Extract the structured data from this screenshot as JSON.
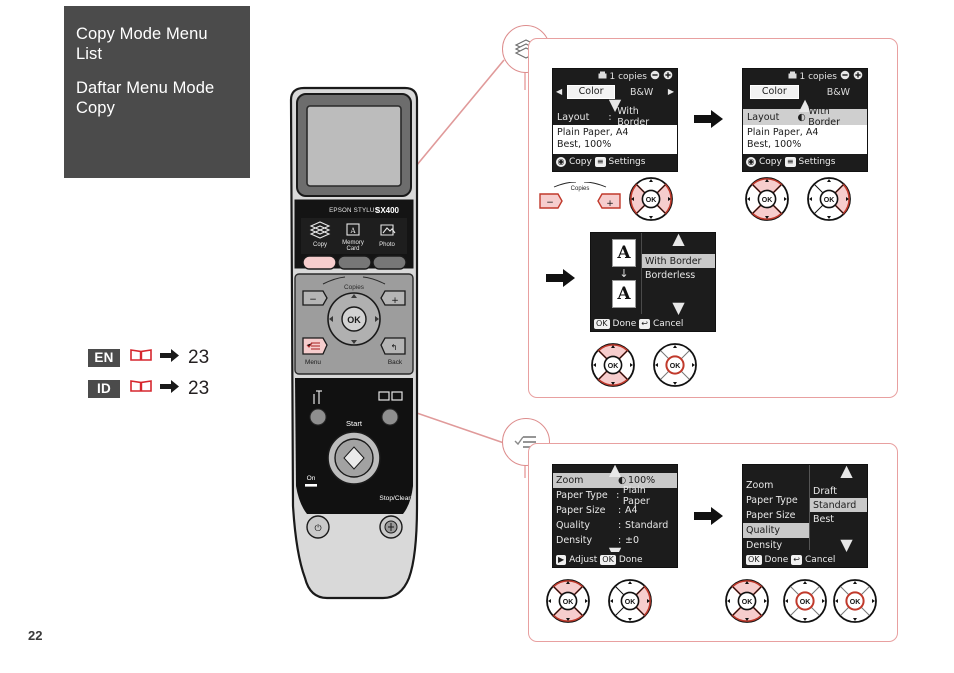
{
  "folio": "22",
  "title_panel": {
    "line_en": "Copy Mode Menu List",
    "line_id": "Daftar Menu Mode Copy"
  },
  "legend": {
    "rows": [
      {
        "lang": "EN",
        "icon": "book-icon",
        "arrow": "right-arrow-icon",
        "page": "23"
      },
      {
        "lang": "ID",
        "icon": "book-icon",
        "arrow": "right-arrow-icon",
        "page": "23"
      }
    ]
  },
  "printer": {
    "brand": "EPSON STYLUS",
    "model": "SX400",
    "mode_buttons": [
      {
        "label": "Copy",
        "icon": "copy-stack-icon"
      },
      {
        "label": "Memory Card",
        "icon": "memory-card-icon"
      },
      {
        "label": "Photo",
        "icon": "photo-icon"
      }
    ],
    "copies_label": "Copies",
    "minus_label": "−",
    "plus_label": "+",
    "ok_label": "OK",
    "menu_label": "Menu",
    "back_label": "Back",
    "start_label": "Start",
    "on_label": "On",
    "stop_clear_label": "Stop/Clear",
    "maintenance_icon": "tools-icon",
    "display_icon": "display-switch-icon",
    "power_icon": "power-icon"
  },
  "callouts": {
    "copy": {
      "badge_icon": "copy-stack-icon"
    },
    "menu": {
      "badge_icon": "menu-list-icon"
    }
  },
  "screens": {
    "copy_home": {
      "copies_icon": "printer-icon",
      "copies_value": "1 copies",
      "minus_icon": "minus-circle-icon",
      "plus_icon": "plus-circle-icon",
      "left_arrow": "◀",
      "right_arrow": "▶",
      "mode_selected": "Color",
      "mode_other": "B&W",
      "caret": "▼",
      "layout_key": "Layout",
      "layout_sep": ":",
      "layout_value": "With Border",
      "paper_line1": "Plain Paper, A4",
      "paper_line2": "Best, 100%",
      "footer_copy_key": "◉",
      "footer_copy": "Copy",
      "footer_settings_key": "≡",
      "footer_settings": "Settings"
    },
    "copy_layout_selected": {
      "copies_icon": "printer-icon",
      "copies_value": "1 copies",
      "minus_icon": "minus-circle-icon",
      "plus_icon": "plus-circle-icon",
      "mode_selected": "Color",
      "mode_other": "B&W",
      "caret": "▲",
      "layout_key": "Layout",
      "layout_bullet": "◐",
      "layout_value": "With Border",
      "paper_line1": "Plain Paper, A4",
      "paper_line2": "Best, 100%",
      "footer_copy_key": "◉",
      "footer_copy": "Copy",
      "footer_settings_key": "≡",
      "footer_settings": "Settings"
    },
    "layout_choice": {
      "preview_top": "A",
      "preview_arrow": "↓",
      "preview_bottom": "A",
      "scroll_up": "▲",
      "scroll_down": "▼",
      "options": [
        {
          "label": "With Border",
          "selected": true
        },
        {
          "label": "Borderless",
          "selected": false
        }
      ],
      "footer_ok_key": "OK",
      "footer_ok": "Done",
      "footer_cancel_key": "↩",
      "footer_cancel": "Cancel"
    },
    "settings_list": {
      "scroll_up": "▲",
      "scroll_down": "▼",
      "rows": [
        {
          "key": "Zoom",
          "sep": "",
          "bullet": "◐",
          "value": "100%",
          "highlight": true
        },
        {
          "key": "Paper Type",
          "sep": ":",
          "bullet": "",
          "value": "Plain Paper",
          "highlight": false
        },
        {
          "key": "Paper Size",
          "sep": ":",
          "bullet": "",
          "value": "A4",
          "highlight": false
        },
        {
          "key": "Quality",
          "sep": ":",
          "bullet": "",
          "value": "Standard",
          "highlight": false
        },
        {
          "key": "Density",
          "sep": ":",
          "bullet": "",
          "value": "±0",
          "highlight": false
        }
      ],
      "footer_adjust_key": "▶",
      "footer_adjust": "Adjust",
      "footer_ok_key": "OK",
      "footer_ok": "Done"
    },
    "quality_dropdown": {
      "scroll_up": "▲",
      "scroll_down": "▼",
      "rows": [
        {
          "key": "Zoom",
          "highlight": false
        },
        {
          "key": "Paper Type",
          "highlight": false
        },
        {
          "key": "Paper Size",
          "highlight": false
        },
        {
          "key": "Quality",
          "highlight": true
        },
        {
          "key": "Density",
          "highlight": false
        }
      ],
      "options": [
        {
          "label": "Draft",
          "selected": false
        },
        {
          "label": "Standard",
          "selected": true
        },
        {
          "label": "Best",
          "selected": false
        }
      ],
      "footer_ok_key": "OK",
      "footer_ok": "Done",
      "footer_cancel_key": "↩",
      "footer_cancel": "Cancel"
    }
  },
  "controls": {
    "ok_label": "OK",
    "copies_label": "Copies",
    "minus_label": "−",
    "plus_label": "+",
    "step_arrow": "➡"
  },
  "colors": {
    "accent_red": "#d6272e",
    "highlight_pink": "#f6cdcd",
    "callout_border": "#e8a0a0",
    "panel_bg": "#4b4b4b",
    "lcd_bg": "#1c1c1c"
  }
}
